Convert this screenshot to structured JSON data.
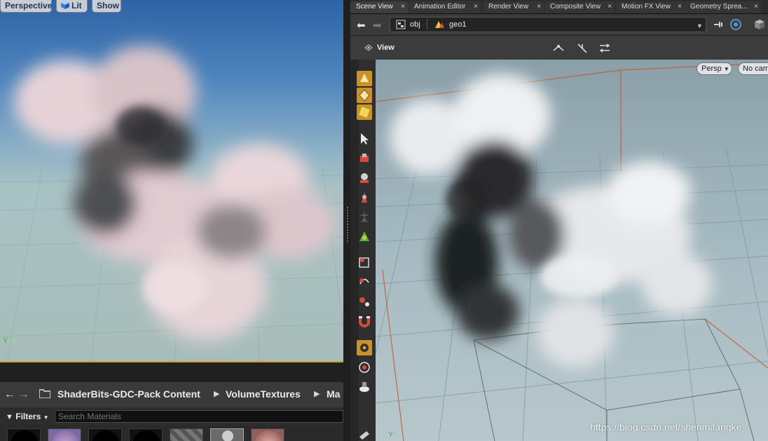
{
  "unreal": {
    "viewport": {
      "perspective_label": "Perspective",
      "lit_label": "Lit",
      "show_label": "Show",
      "axis_label": "Y"
    },
    "content_browser": {
      "breadcrumbs": [
        "ShaderBits-GDC-Pack Content",
        "VolumeTextures",
        "Ma"
      ],
      "filters_label": "Filters",
      "search_placeholder": "Search Materials"
    }
  },
  "houdini": {
    "tabs": [
      {
        "label": "Scene View"
      },
      {
        "label": "Animation Editor"
      },
      {
        "label": "Render View"
      },
      {
        "label": "Composite View"
      },
      {
        "label": "Motion FX View"
      },
      {
        "label": "Geometry Sprea..."
      }
    ],
    "path": {
      "root": "obj",
      "node": "geo1"
    },
    "view_label": "View",
    "viewport": {
      "camera_label": "Persp",
      "cam_label": "No cam",
      "axis_label": "Y"
    }
  },
  "watermark": "https://blog.csdn.net/shenmifangke",
  "colors": {
    "accent": "#c9932a",
    "selection_border": "#c9a22a"
  }
}
